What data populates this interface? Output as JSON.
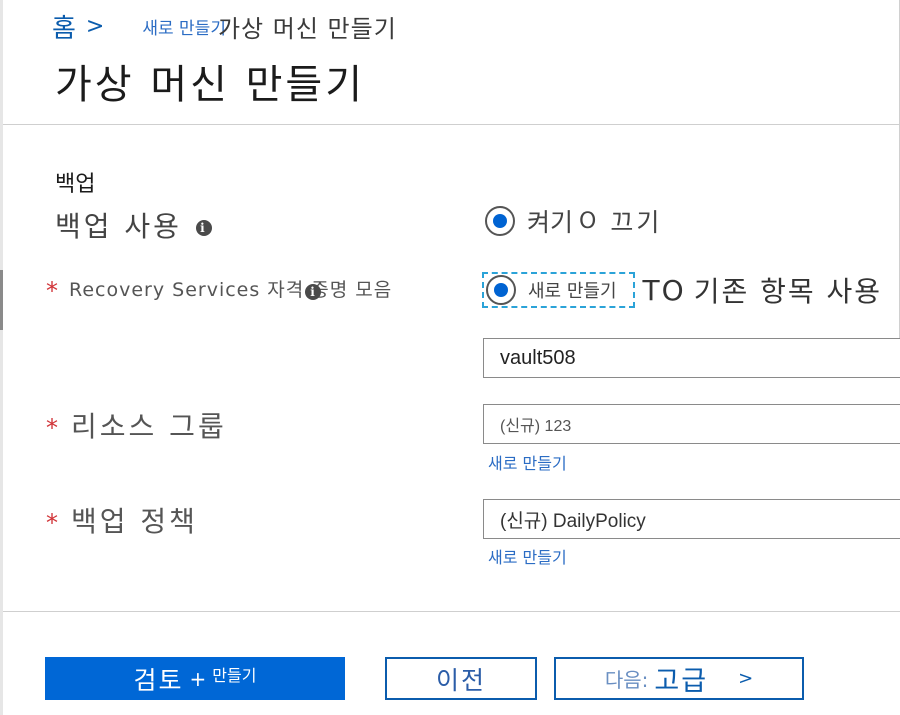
{
  "breadcrumb": {
    "home": "홈",
    "separator": ">",
    "link": "새로 만들기",
    "current": "가상 머신 만들기"
  },
  "page_title": "가상 머신 만들기",
  "section": {
    "heading": "백업"
  },
  "backup_enable": {
    "label": "백업 사용",
    "info_icon": "info-icon",
    "on_label": "켜기",
    "off_glyph": "O",
    "off_label": "끄기",
    "selected": "on"
  },
  "vault": {
    "required_mark": "*",
    "label": "Recovery Services 자격 증명 모음",
    "option_new": "새로 만들기",
    "option_existing_prefix": "TO",
    "option_existing": "기존 항목 사용",
    "selected": "new",
    "value": "vault508"
  },
  "resource_group": {
    "required_mark": "*",
    "label": "리소스 그룹",
    "value": "(신규) 123",
    "create_link": "새로 만들기"
  },
  "backup_policy": {
    "required_mark": "*",
    "label": "백업 정책",
    "value": "(신규) DailyPolicy",
    "create_link": "새로 만들기"
  },
  "footer": {
    "review_big": "검토",
    "review_plus": "+",
    "review_small": "만들기",
    "previous": "이전",
    "next_prefix": "다음:",
    "next_value": "고급",
    "next_arrow": ">"
  },
  "colors": {
    "accent": "#0067d6",
    "link": "#2b6cc4",
    "required": "#d13438",
    "focus_outline": "#2ba3d8"
  }
}
